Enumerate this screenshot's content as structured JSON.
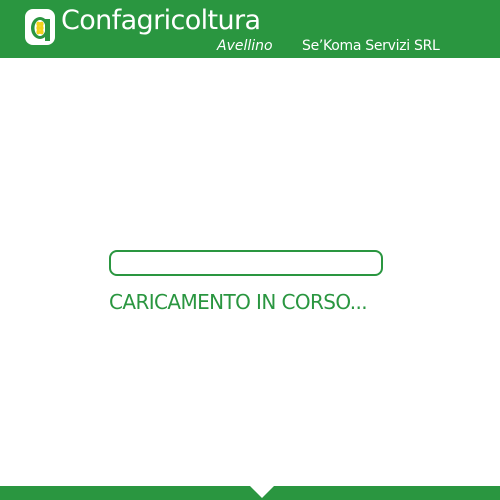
{
  "header": {
    "logo_icon": "confagricoltura-logo-icon",
    "brand_name": "Confagricoltura",
    "brand_sub": "Avellino",
    "company": "Se’Koma Servizi SRL"
  },
  "loading": {
    "progress": 0,
    "text": "CARICAMENTO IN CORSO..."
  },
  "colors": {
    "brand_green": "#2a9640",
    "logo_yellow": "#f2d21a",
    "background": "#ffffff"
  }
}
